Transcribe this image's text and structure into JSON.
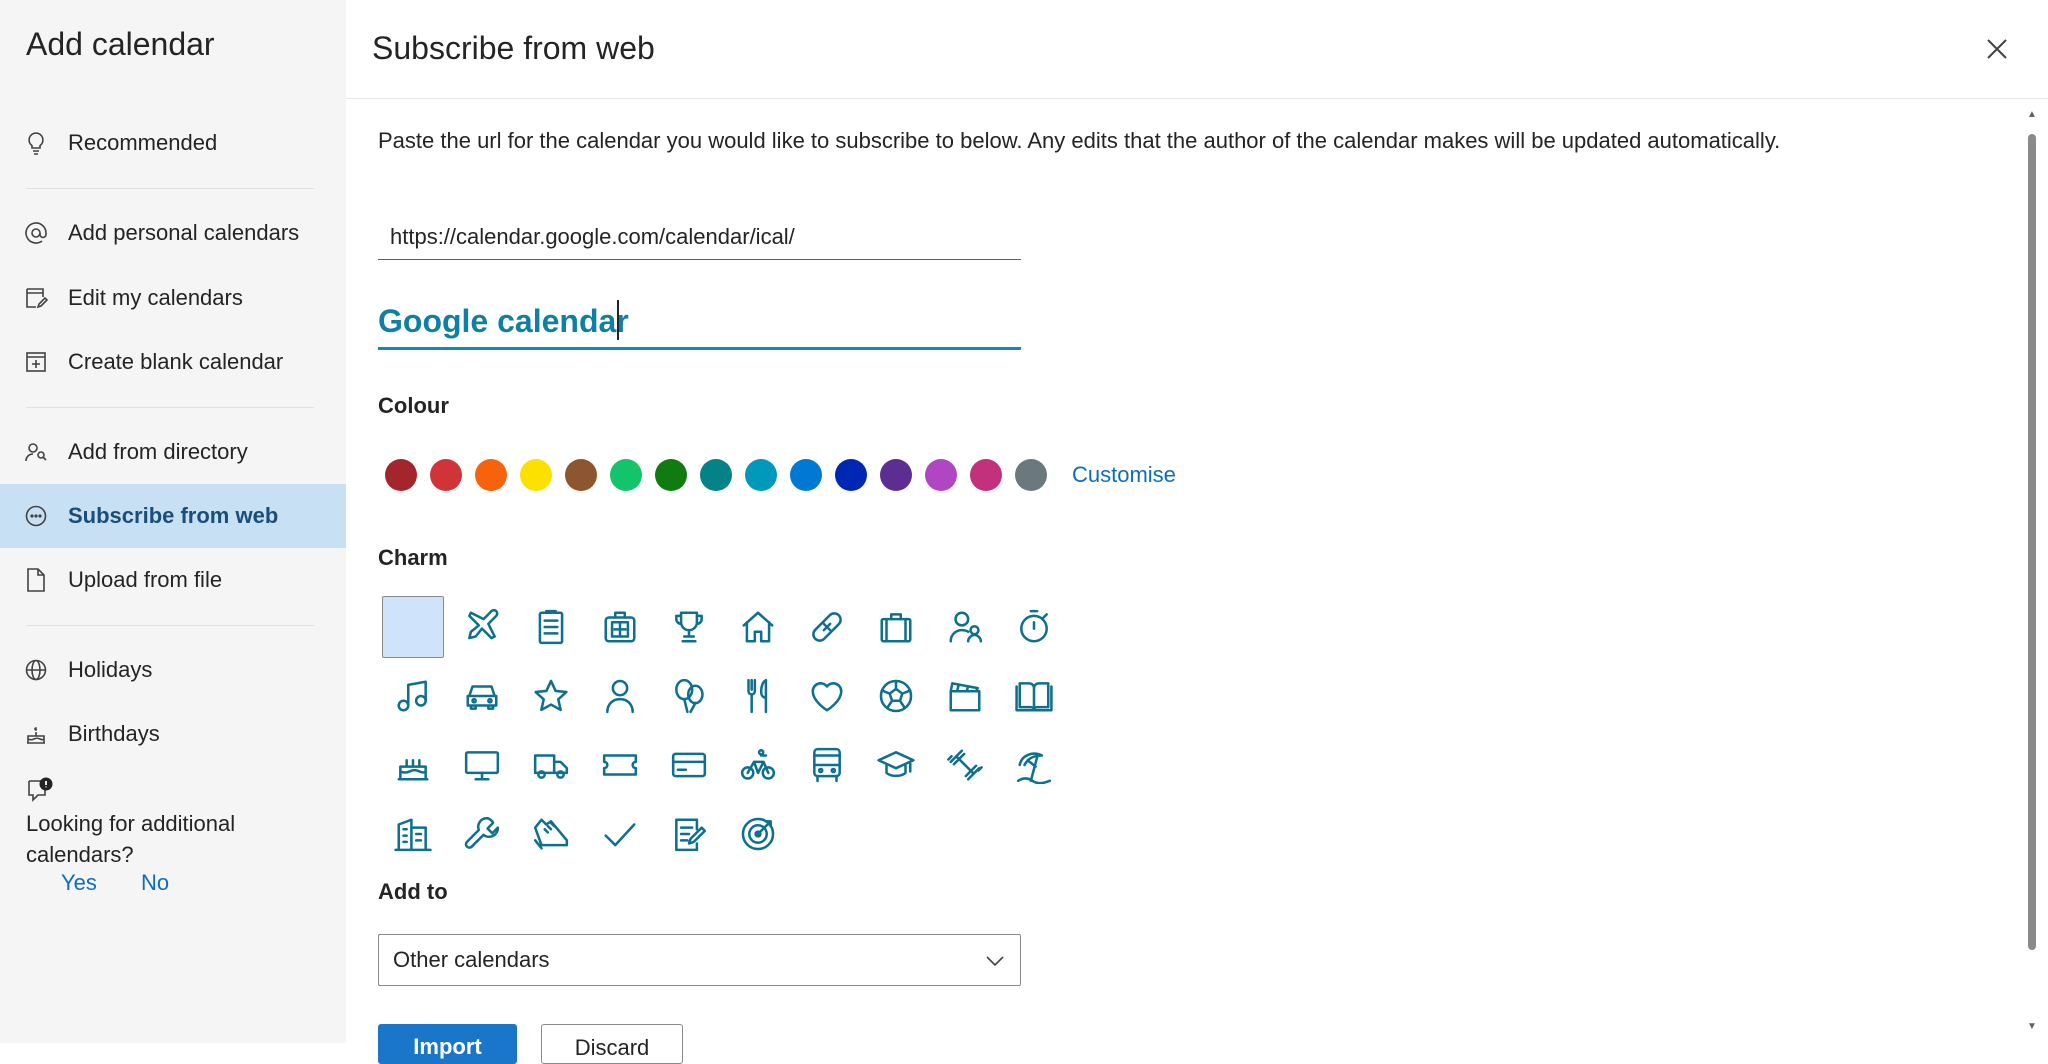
{
  "sidebar": {
    "title": "Add calendar",
    "items": [
      {
        "label": "Recommended",
        "icon": "lightbulb-icon"
      },
      {
        "label": "Add personal calendars",
        "icon": "at-sign-icon"
      },
      {
        "label": "Edit my calendars",
        "icon": "edit-calendar-icon"
      },
      {
        "label": "Create blank calendar",
        "icon": "calendar-add-icon"
      },
      {
        "label": "Add from directory",
        "icon": "people-search-icon"
      },
      {
        "label": "Subscribe from web",
        "icon": "more-circle-icon",
        "active": true
      },
      {
        "label": "Upload from file",
        "icon": "document-icon"
      },
      {
        "label": "Holidays",
        "icon": "globe-icon"
      },
      {
        "label": "Birthdays",
        "icon": "cake-icon"
      }
    ],
    "feedback": {
      "question": "Looking for additional calendars?",
      "yes": "Yes",
      "no": "No"
    }
  },
  "header": {
    "title": "Subscribe from web"
  },
  "main": {
    "description": "Paste the url for the calendar you would like to subscribe to below. Any edits that the author of the calendar makes will be updated automatically.",
    "url_value": "https://calendar.google.com/calendar/ical/",
    "name_value": "Google calendar",
    "colour_label": "Colour",
    "colours": [
      "#a4262c",
      "#d13438",
      "#f7630c",
      "#fce100",
      "#8e562e",
      "#13c46a",
      "#107c10",
      "#038387",
      "#0099bc",
      "#0078d4",
      "#0027b4",
      "#5c2e91",
      "#b146c2",
      "#c3307c",
      "#69797e"
    ],
    "customise_label": "Customise",
    "charm_label": "Charm",
    "charms": [
      "none",
      "airplane",
      "clipboard",
      "medical-bag",
      "trophy",
      "home",
      "bandage",
      "briefcase",
      "people",
      "stopwatch",
      "music-note",
      "car",
      "star",
      "person",
      "balloons",
      "fork-knife",
      "heart",
      "soccer-ball",
      "clapperboard",
      "book",
      "cake",
      "monitor",
      "truck",
      "ticket",
      "credit-card",
      "bicycle",
      "bus",
      "graduation-cap",
      "dumbbell",
      "beach",
      "building",
      "wrench",
      "sneaker",
      "checkmark",
      "notepad",
      "target"
    ],
    "selected_charm": 0,
    "add_to_label": "Add to",
    "add_to_value": "Other calendars",
    "import_label": "Import",
    "discard_label": "Discard"
  }
}
